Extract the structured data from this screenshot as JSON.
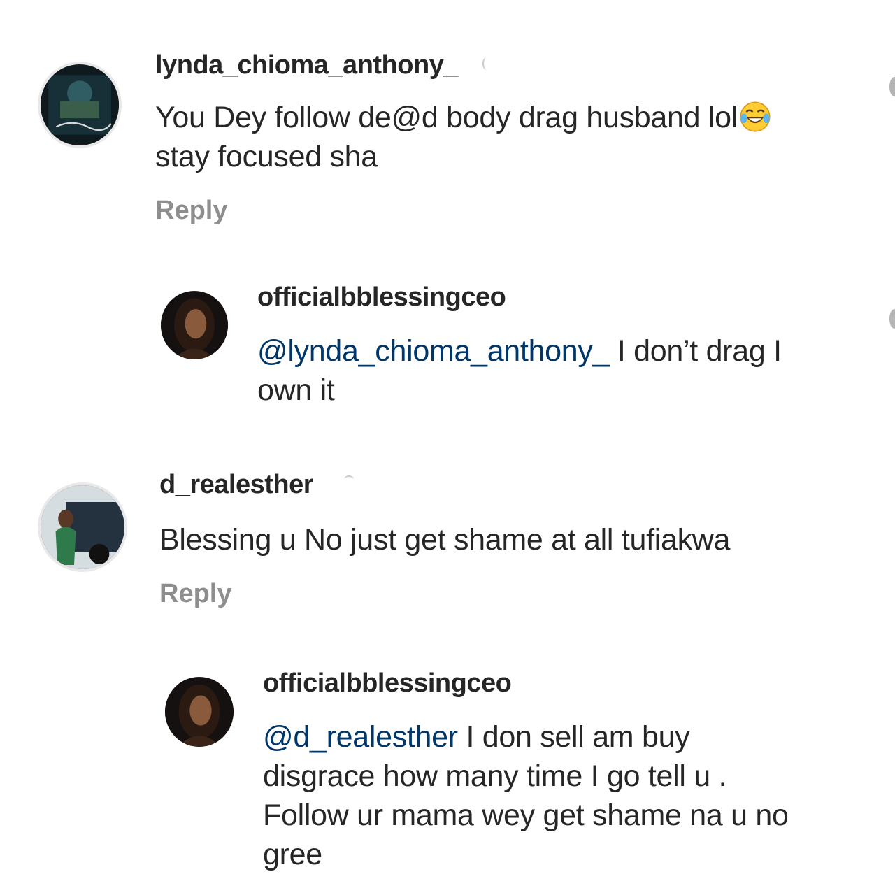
{
  "comments": [
    {
      "username": "lynda_chioma_anthony_",
      "text": "You Dey follow de@d body drag husband lol",
      "text_line2": "stay focused sha",
      "emoji": "tears-of-joy-emoji",
      "reply_label": "Reply",
      "replies": [
        {
          "username": "officialbblessingceo",
          "mention": "@lynda_chioma_anthony_",
          "text": " I don’t drag I",
          "text_line2": "own it"
        }
      ]
    },
    {
      "username": "d_realesther",
      "text": "Blessing u No just get shame at all tufiakwa",
      "reply_label": "Reply",
      "replies": [
        {
          "username": "officialbblessingceo",
          "mention": "@d_realesther",
          "text": " I don sell am buy",
          "text_line2": "disgrace how many time I go tell u .",
          "text_line3": "Follow ur mama wey get shame na u no",
          "text_line4": "gree"
        }
      ]
    }
  ],
  "colors": {
    "text": "#262626",
    "mention": "#00376b",
    "secondary": "#8e8e8e",
    "background": "#ffffff"
  }
}
